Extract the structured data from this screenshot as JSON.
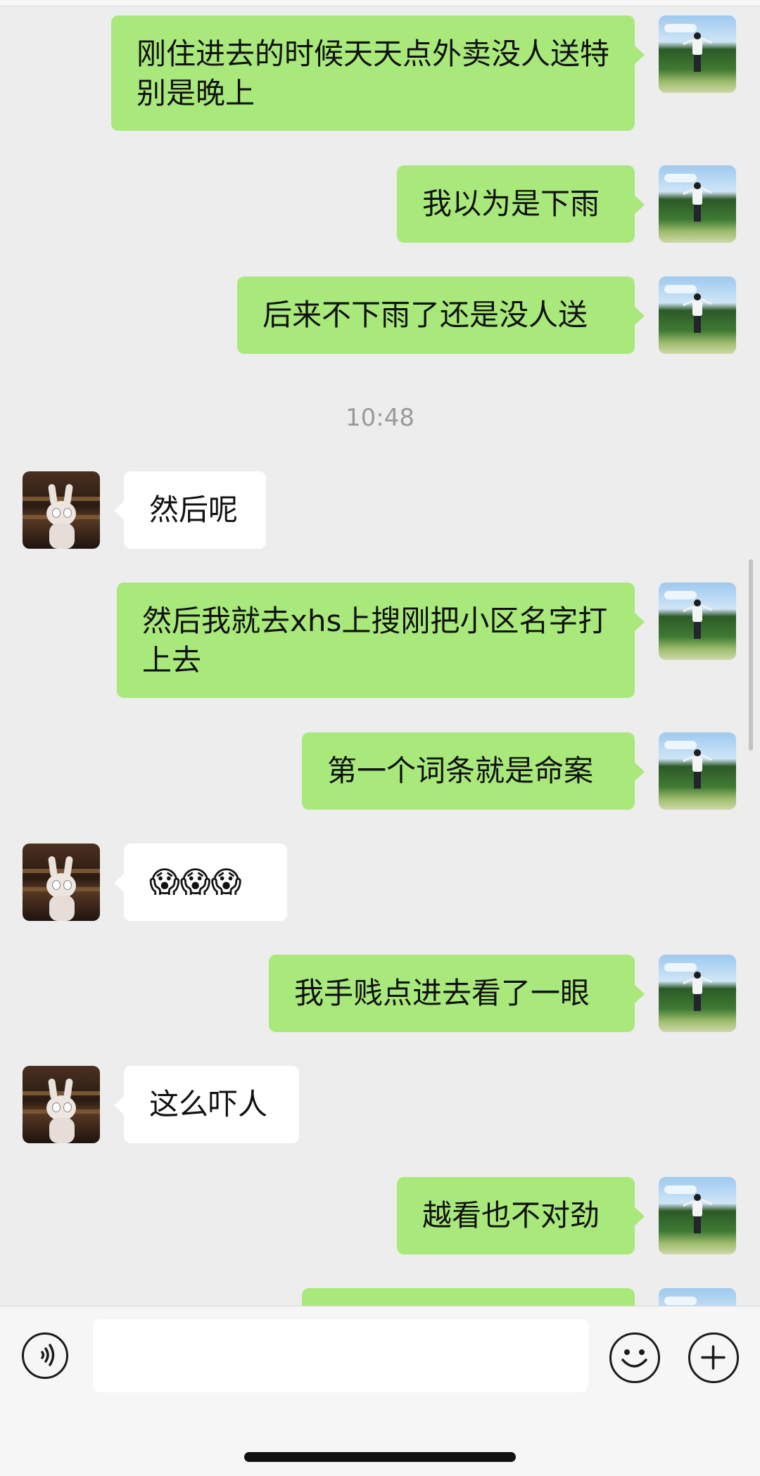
{
  "chat": {
    "messages": [
      {
        "side": "me",
        "text": "刚住进去的时候天天点外卖没人送特别是晚上"
      },
      {
        "side": "me",
        "text": "我以为是下雨"
      },
      {
        "side": "me",
        "text": "后来不下雨了还是没人送"
      },
      {
        "side": "other",
        "text": "然后呢"
      },
      {
        "side": "me",
        "text": "然后我就去xhs上搜刚把小区名字打上去"
      },
      {
        "side": "me",
        "text": "第一个词条就是命案"
      },
      {
        "side": "other",
        "text": "😱😱😱"
      },
      {
        "side": "me",
        "text": "我手贱点进去看了一眼"
      },
      {
        "side": "other",
        "text": "这么吓人"
      },
      {
        "side": "me",
        "text": "越看也不对劲"
      }
    ],
    "timestamp": "10:48"
  },
  "input_bar": {
    "voice_icon": "voice-icon",
    "emoji_icon": "emoji-icon",
    "plus_icon": "plus-icon",
    "text_value": ""
  },
  "colors": {
    "background": "#ededed",
    "my_bubble": "#a9e97b",
    "other_bubble": "#ffffff"
  }
}
